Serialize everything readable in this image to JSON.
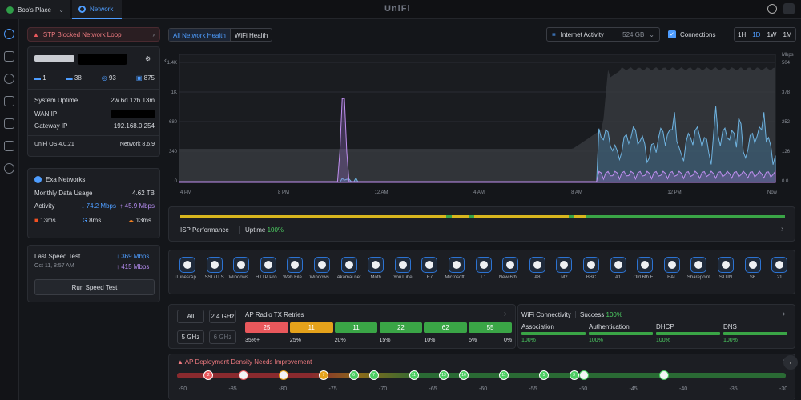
{
  "topbar": {
    "site": "Bob's Place",
    "app": "Network",
    "logo": "UniFi"
  },
  "alert": {
    "text": "STP Blocked Network Loop"
  },
  "gateway": {
    "stats": [
      "1",
      "38",
      "93",
      "875"
    ],
    "uptime_label": "System Uptime",
    "uptime": "2w 6d 12h 13m",
    "wan_label": "WAN IP",
    "gw_label": "Gateway IP",
    "gw": "192.168.0.254",
    "os": "UniFi OS 4.0.21",
    "net": "Network 8.6.9"
  },
  "isp": {
    "name": "Exa Networks",
    "usage_label": "Monthly Data Usage",
    "usage": "4.62 TB",
    "activity_label": "Activity",
    "down": "↓ 74.2 Mbps",
    "up": "↑ 45.9 Mbps",
    "latencies": [
      "13ms",
      "8ms",
      "13ms"
    ]
  },
  "speed": {
    "label": "Last Speed Test",
    "date": "Oct 11, 8:57 AM",
    "down": "↓ 369 Mbps",
    "up": "↑ 415 Mbps",
    "button": "Run Speed Test"
  },
  "health_tabs": [
    "All Network Health",
    "WiFi Health"
  ],
  "controls": {
    "activity": "Internet Activity",
    "volume": "524 GB",
    "connections": "Connections",
    "ranges": [
      "1H",
      "1D",
      "1W",
      "1M"
    ]
  },
  "chart_data": {
    "type": "area",
    "x": [
      "4 PM",
      "8 PM",
      "12 AM",
      "4 AM",
      "8 AM",
      "12 PM",
      "Now"
    ],
    "left_ticks": [
      "0",
      "340",
      "680",
      "1K",
      "1.4K"
    ],
    "right_ticks": [
      "0.0",
      "126",
      "252",
      "378",
      "504"
    ],
    "right_unit": "Mbps",
    "series": [
      {
        "values": [
          0,
          0,
          0,
          0,
          1500,
          0,
          0,
          0,
          0,
          0,
          0,
          0,
          0
        ]
      },
      {
        "values": [
          0,
          0,
          0,
          0,
          0,
          0,
          0,
          0,
          0,
          150,
          300,
          200,
          400
        ]
      }
    ]
  },
  "isp_perf": {
    "label": "ISP Performance",
    "uptime_label": "Uptime",
    "uptime": "100%"
  },
  "apps": [
    "iTunes/Ap...",
    "SSL/TLS",
    "Windows ...",
    "HTTP Pro...",
    "Web File ...",
    "Windows ...",
    "Akamai.net",
    "Móth",
    "YouTube",
    "E7",
    "Microsoft...",
    "L1",
    "New 6th ...",
    "A8",
    "M2",
    "BBC",
    "A1",
    "Old 6th F...",
    "EAL",
    "Sharepoint",
    "STUN",
    "S6",
    "21"
  ],
  "bands": [
    "All",
    "2.4 GHz",
    "5 GHz",
    "6 GHz"
  ],
  "retries": {
    "title": "AP Radio TX Retries",
    "values": [
      "25",
      "11",
      "11",
      "22",
      "62",
      "55"
    ],
    "labels": [
      "35%+",
      "25%",
      "20%",
      "15%",
      "10%",
      "5%",
      "0%"
    ],
    "colors": [
      "#e9585c",
      "#e5a21b",
      "#3aa546",
      "#3aa546",
      "#3aa546",
      "#3aa546"
    ]
  },
  "wifi": {
    "title": "WiFi Connectivity",
    "success_label": "Success",
    "success": "100%",
    "items": [
      {
        "name": "Association",
        "value": "100%"
      },
      {
        "name": "Authentication",
        "value": "100%"
      },
      {
        "name": "DHCP",
        "value": "100%"
      },
      {
        "name": "DNS",
        "value": "100%"
      }
    ]
  },
  "density": {
    "title": "AP Deployment Density Needs Improvement",
    "ticks": [
      "-90",
      "-85",
      "-80",
      "-75",
      "-70",
      "-65",
      "-60",
      "-55",
      "-50",
      "-45",
      "-40",
      "-35",
      "-30"
    ],
    "markers": [
      {
        "v": -87.5,
        "t": "2",
        "c": "#e9585c"
      },
      {
        "v": -84,
        "t": "",
        "c": "#e9585c"
      },
      {
        "v": -80,
        "t": "",
        "c": "#e5a21b"
      },
      {
        "v": -76,
        "t": "7",
        "c": "#e5a21b"
      },
      {
        "v": -73,
        "t": "6",
        "c": "#4ccd62"
      },
      {
        "v": -71,
        "t": "7",
        "c": "#4ccd62"
      },
      {
        "v": -67,
        "t": "11",
        "c": "#4ccd62"
      },
      {
        "v": -64,
        "t": "13",
        "c": "#4ccd62"
      },
      {
        "v": -62,
        "t": "16",
        "c": "#4ccd62"
      },
      {
        "v": -58,
        "t": "11",
        "c": "#4ccd62"
      },
      {
        "v": -54,
        "t": "5",
        "c": "#4ccd62"
      },
      {
        "v": -51,
        "t": "3",
        "c": "#4ccd62"
      },
      {
        "v": -50,
        "t": "",
        "c": "#4ccd62"
      },
      {
        "v": -42,
        "t": "",
        "c": "#4ccd62"
      }
    ]
  }
}
